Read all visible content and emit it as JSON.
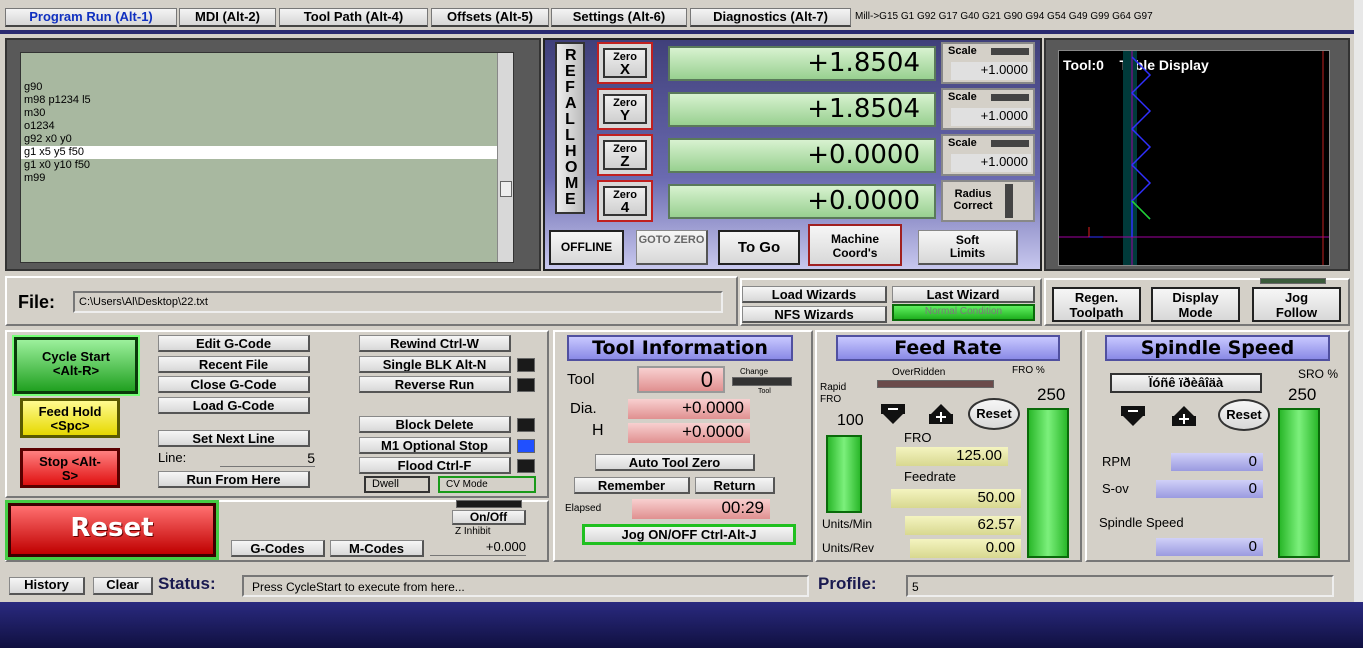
{
  "tabs": [
    "Program Run (Alt-1)",
    "MDI (Alt-2)",
    "Tool Path (Alt-4)",
    "Offsets (Alt-5)",
    "Settings (Alt-6)",
    "Diagnostics (Alt-7)"
  ],
  "modal_codes": "Mill->G15  G1 G92 G17 G40 G21 G90 G94 G54 G49 G99 G64 G97",
  "gcode_lines": [
    "g90",
    "m98 p1234 l5",
    "m30",
    "o1234",
    "g92 x0 y0",
    "g1 x5 y5 f50",
    "g1 x0 y10 f50",
    "m99"
  ],
  "ref_all_home": "REF ALL HOME",
  "axes": [
    {
      "zero": "Zero",
      "axis": "X",
      "value": "+1.8504",
      "scale_label": "Scale",
      "scale": "+1.0000"
    },
    {
      "zero": "Zero",
      "axis": "Y",
      "value": "+1.8504",
      "scale_label": "Scale",
      "scale": "+1.0000"
    },
    {
      "zero": "Zero",
      "axis": "Z",
      "value": "+0.0000",
      "scale_label": "Scale",
      "scale": "+1.0000"
    },
    {
      "zero": "Zero",
      "axis": "4",
      "value": "+0.0000",
      "radius_label": "Radius Correct"
    }
  ],
  "dro_buttons": {
    "offline": "OFFLINE",
    "goto_zero": "GOTO ZERO",
    "to_go": "To Go",
    "machine_coords": "Machine Coord's",
    "soft_limits": "Soft Limits"
  },
  "toolpath": {
    "title": "Tool:0    Table Display"
  },
  "file": {
    "label": "File:",
    "path": "C:\\Users\\Al\\Desktop\\22.txt"
  },
  "wizards": {
    "load": "Load Wizards",
    "last": "Last Wizard",
    "nfs": "NFS Wizards",
    "normal": "Normal Condition"
  },
  "view_buttons": {
    "regen": "Regen. Toolpath",
    "display_mode": "Display Mode",
    "jog_follow": "Jog Follow"
  },
  "controls": {
    "cycle_start": "Cycle Start <Alt-R>",
    "feed_hold": "Feed Hold <Spc>",
    "stop": "Stop <Alt-S>",
    "reset": "Reset",
    "edit": "Edit G-Code",
    "recent": "Recent File",
    "close": "Close G-Code",
    "load": "Load G-Code",
    "set_next": "Set Next Line",
    "line_label": "Line:",
    "line_value": "5",
    "run_from": "Run From Here",
    "rewind": "Rewind Ctrl-W",
    "single_blk": "Single BLK Alt-N",
    "reverse": "Reverse Run",
    "block_delete": "Block Delete",
    "m1": "M1 Optional Stop",
    "flood": "Flood Ctrl-F",
    "dwell": "Dwell",
    "cv": "CV Mode",
    "onoff": "On/Off",
    "z_inhibit": "Z Inhibit",
    "z_value": "+0.000",
    "gcodes": "G-Codes",
    "mcodes": "M-Codes"
  },
  "tool": {
    "title": "Tool Information",
    "tool_label": "Tool",
    "tool_value": "0",
    "change": "Change",
    "change_tool": "Tool",
    "dia_label": "Dia.",
    "dia": "+0.0000",
    "h_label": "H",
    "h": "+0.0000",
    "auto_zero": "Auto Tool Zero",
    "remember": "Remember",
    "return": "Return",
    "elapsed_label": "Elapsed",
    "elapsed": "00:29",
    "jog": "Jog ON/OFF Ctrl-Alt-J"
  },
  "feed": {
    "title": "Feed Rate",
    "overridden": "OverRidden",
    "fro_pct": "FRO %",
    "fro_pct_value": "250",
    "rapid": "Rapid FRO",
    "rapid_value": "100",
    "reset": "Reset",
    "fro_label": "FRO",
    "fro": "125.00",
    "feedrate_label": "Feedrate",
    "feedrate": "50.00",
    "units_min_label": "Units/Min",
    "units_min": "62.57",
    "units_rev_label": "Units/Rev",
    "units_rev": "0.00"
  },
  "spindle": {
    "title": "Spindle Speed",
    "cw": "Ïóñê ïðèâîäà",
    "sro": "SRO %",
    "sro_value": "250",
    "reset": "Reset",
    "rpm_label": "RPM",
    "rpm": "0",
    "sov_label": "S-ov",
    "sov": "0",
    "speed_label": "Spindle Speed",
    "speed": "0"
  },
  "status": {
    "history": "History",
    "clear": "Clear",
    "label": "Status:",
    "message": "Press CycleStart to execute from here...",
    "profile_label": "Profile:",
    "profile": "5"
  },
  "colors": {
    "dro_green": "#98d090",
    "header_blue": "#8a8ae6",
    "bottom_bar": "#1a1a60"
  }
}
